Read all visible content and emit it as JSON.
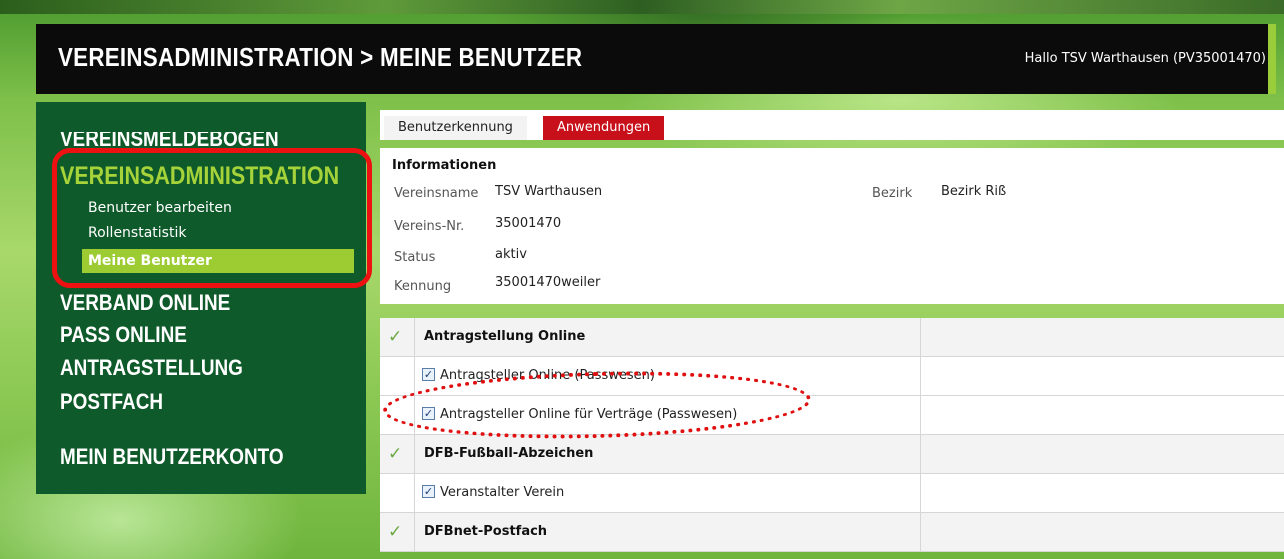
{
  "header": {
    "title": "VEREINSADMINISTRATION > MEINE BENUTZER",
    "greeting": "Hallo TSV Warthausen (PV35001470)"
  },
  "sidebar": {
    "items": [
      {
        "label": "VEREINSMELDEBOGEN"
      },
      {
        "label": "VEREINSADMINISTRATION"
      },
      {
        "label": "VERBAND ONLINE"
      },
      {
        "label": "PASS ONLINE"
      },
      {
        "label": "ANTRAGSTELLUNG"
      },
      {
        "label": "POSTFACH"
      },
      {
        "label": "MEIN BENUTZERKONTO"
      }
    ],
    "subitems": [
      {
        "label": "Benutzer bearbeiten"
      },
      {
        "label": "Rollenstatistik"
      },
      {
        "label": "Meine Benutzer"
      }
    ]
  },
  "tabs": [
    {
      "label": "Benutzerkennung"
    },
    {
      "label": "Anwendungen"
    }
  ],
  "info": {
    "title": "Informationen",
    "vereinsname_label": "Vereinsname",
    "vereinsname": "TSV Warthausen",
    "vereinsnr_label": "Vereins-Nr.",
    "vereinsnr": "35001470",
    "status_label": "Status",
    "status": "aktiv",
    "kennung_label": "Kennung",
    "kennung": "35001470weiler",
    "bezirk_label": "Bezirk",
    "bezirk": "Bezirk Riß"
  },
  "applications": {
    "groups": [
      {
        "label": "Antragstellung Online"
      },
      {
        "label": "DFB-Fußball-Abzeichen"
      },
      {
        "label": "DFBnet-Postfach"
      }
    ],
    "items": [
      {
        "label": "Antragsteller Online (Passwesen)"
      },
      {
        "label": "Antragsteller Online für Verträge (Passwesen)"
      },
      {
        "label": "Veranstalter Verein"
      }
    ],
    "check_glyph": "✓",
    "checkbox_glyph": "✓"
  },
  "colors": {
    "header_bg": "#0b0b0b",
    "sidebar_bg": "#0e5a2a",
    "active_green": "#a6d33a",
    "current_item_bg": "#9ccc32",
    "tab_active": "#c8101a",
    "highlight_red": "#ee1111"
  }
}
